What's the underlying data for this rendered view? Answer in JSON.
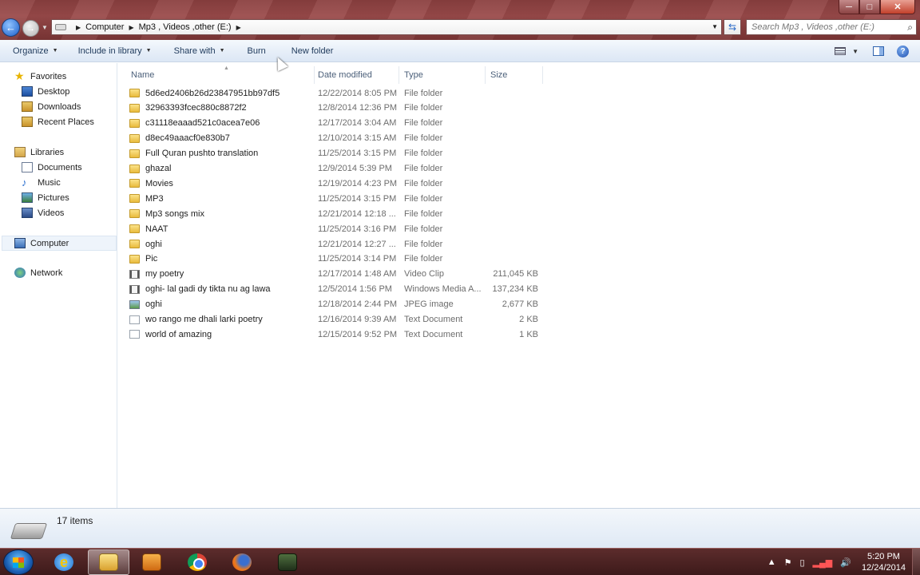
{
  "window": {
    "controls": {
      "minimize": "─",
      "maximize": "□",
      "close": "✕"
    }
  },
  "address": {
    "crumbs": [
      "Computer",
      "Mp3 , Videos ,other (E:)"
    ],
    "search_placeholder": "Search Mp3 , Videos ,other (E:)"
  },
  "toolbar": {
    "organize": "Organize",
    "include": "Include in library",
    "share": "Share with",
    "burn": "Burn",
    "new_folder": "New folder",
    "help": "?"
  },
  "nav": {
    "favorites": "Favorites",
    "desktop": "Desktop",
    "downloads": "Downloads",
    "recent": "Recent Places",
    "libraries": "Libraries",
    "documents": "Documents",
    "music": "Music",
    "pictures": "Pictures",
    "videos": "Videos",
    "computer": "Computer",
    "network": "Network"
  },
  "columns": {
    "name": "Name",
    "date": "Date modified",
    "type": "Type",
    "size": "Size"
  },
  "files": [
    {
      "name": "5d6ed2406b26d23847951bb97df5",
      "date": "12/22/2014 8:05 PM",
      "type": "File folder",
      "size": "",
      "icon": "folder-icon"
    },
    {
      "name": "32963393fcec880c8872f2",
      "date": "12/8/2014 12:36 PM",
      "type": "File folder",
      "size": "",
      "icon": "folder-icon"
    },
    {
      "name": "c31118eaaad521c0acea7e06",
      "date": "12/17/2014 3:04 AM",
      "type": "File folder",
      "size": "",
      "icon": "folder-icon"
    },
    {
      "name": "d8ec49aaacf0e830b7",
      "date": "12/10/2014 3:15 AM",
      "type": "File folder",
      "size": "",
      "icon": "folder-icon"
    },
    {
      "name": "Full Quran pushto translation",
      "date": "11/25/2014 3:15 PM",
      "type": "File folder",
      "size": "",
      "icon": "folder-icon"
    },
    {
      "name": "ghazal",
      "date": "12/9/2014 5:39 PM",
      "type": "File folder",
      "size": "",
      "icon": "folder-icon"
    },
    {
      "name": "Movies",
      "date": "12/19/2014 4:23 PM",
      "type": "File folder",
      "size": "",
      "icon": "folder-icon"
    },
    {
      "name": "MP3",
      "date": "11/25/2014 3:15 PM",
      "type": "File folder",
      "size": "",
      "icon": "folder-icon"
    },
    {
      "name": "Mp3 songs mix",
      "date": "12/21/2014 12:18 ...",
      "type": "File folder",
      "size": "",
      "icon": "folder-icon"
    },
    {
      "name": "NAAT",
      "date": "11/25/2014 3:16 PM",
      "type": "File folder",
      "size": "",
      "icon": "folder-icon"
    },
    {
      "name": "oghi",
      "date": "12/21/2014 12:27 ...",
      "type": "File folder",
      "size": "",
      "icon": "folder-icon"
    },
    {
      "name": "Pic",
      "date": "11/25/2014 3:14 PM",
      "type": "File folder",
      "size": "",
      "icon": "folder-icon"
    },
    {
      "name": "my poetry",
      "date": "12/17/2014 1:48 AM",
      "type": "Video Clip",
      "size": "211,045 KB",
      "icon": "video-file-icon"
    },
    {
      "name": "oghi- lal gadi dy tikta nu ag lawa",
      "date": "12/5/2014 1:56 PM",
      "type": "Windows Media A...",
      "size": "137,234 KB",
      "icon": "media-file-icon"
    },
    {
      "name": "oghi",
      "date": "12/18/2014 2:44 PM",
      "type": "JPEG image",
      "size": "2,677 KB",
      "icon": "image-file-icon"
    },
    {
      "name": "wo rango me dhali larki poetry",
      "date": "12/16/2014 9:39 AM",
      "type": "Text Document",
      "size": "2 KB",
      "icon": "text-file-icon"
    },
    {
      "name": "world of amazing",
      "date": "12/15/2014 9:52 PM",
      "type": "Text Document",
      "size": "1 KB",
      "icon": "text-file-icon"
    }
  ],
  "status": {
    "count": "17 items"
  },
  "taskbar": {
    "time": "5:20 PM",
    "date": "12/24/2014"
  }
}
